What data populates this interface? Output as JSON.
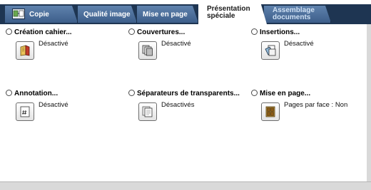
{
  "tabs": [
    {
      "label": "Copie"
    },
    {
      "label": "Qualité image"
    },
    {
      "label": "Mise en page"
    },
    {
      "label": "Présentation spéciale"
    },
    {
      "label": "Assemblage documents"
    }
  ],
  "active_tab": "Présentation spéciale",
  "options": [
    {
      "title": "Création cahier...",
      "value": "Désactivé",
      "icon": "booklet-icon"
    },
    {
      "title": "Couvertures...",
      "value": "Désactivé",
      "icon": "covers-icon"
    },
    {
      "title": "Insertions...",
      "value": "Désactivé",
      "icon": "inserts-icon"
    },
    {
      "title": "Annotation...",
      "value": "Désactivé",
      "icon": "annotation-icon"
    },
    {
      "title": "Séparateurs de transparents...",
      "value": "Désactivés",
      "icon": "transparency-separators-icon"
    },
    {
      "title": "Mise en page...",
      "value": "Pages par face : Non",
      "icon": "page-layout-icon"
    }
  ],
  "colors": {
    "tab_blue": "#4a6b96",
    "tab_bar_dark": "#1e3552",
    "active_tab_bg": "#ffffff"
  }
}
